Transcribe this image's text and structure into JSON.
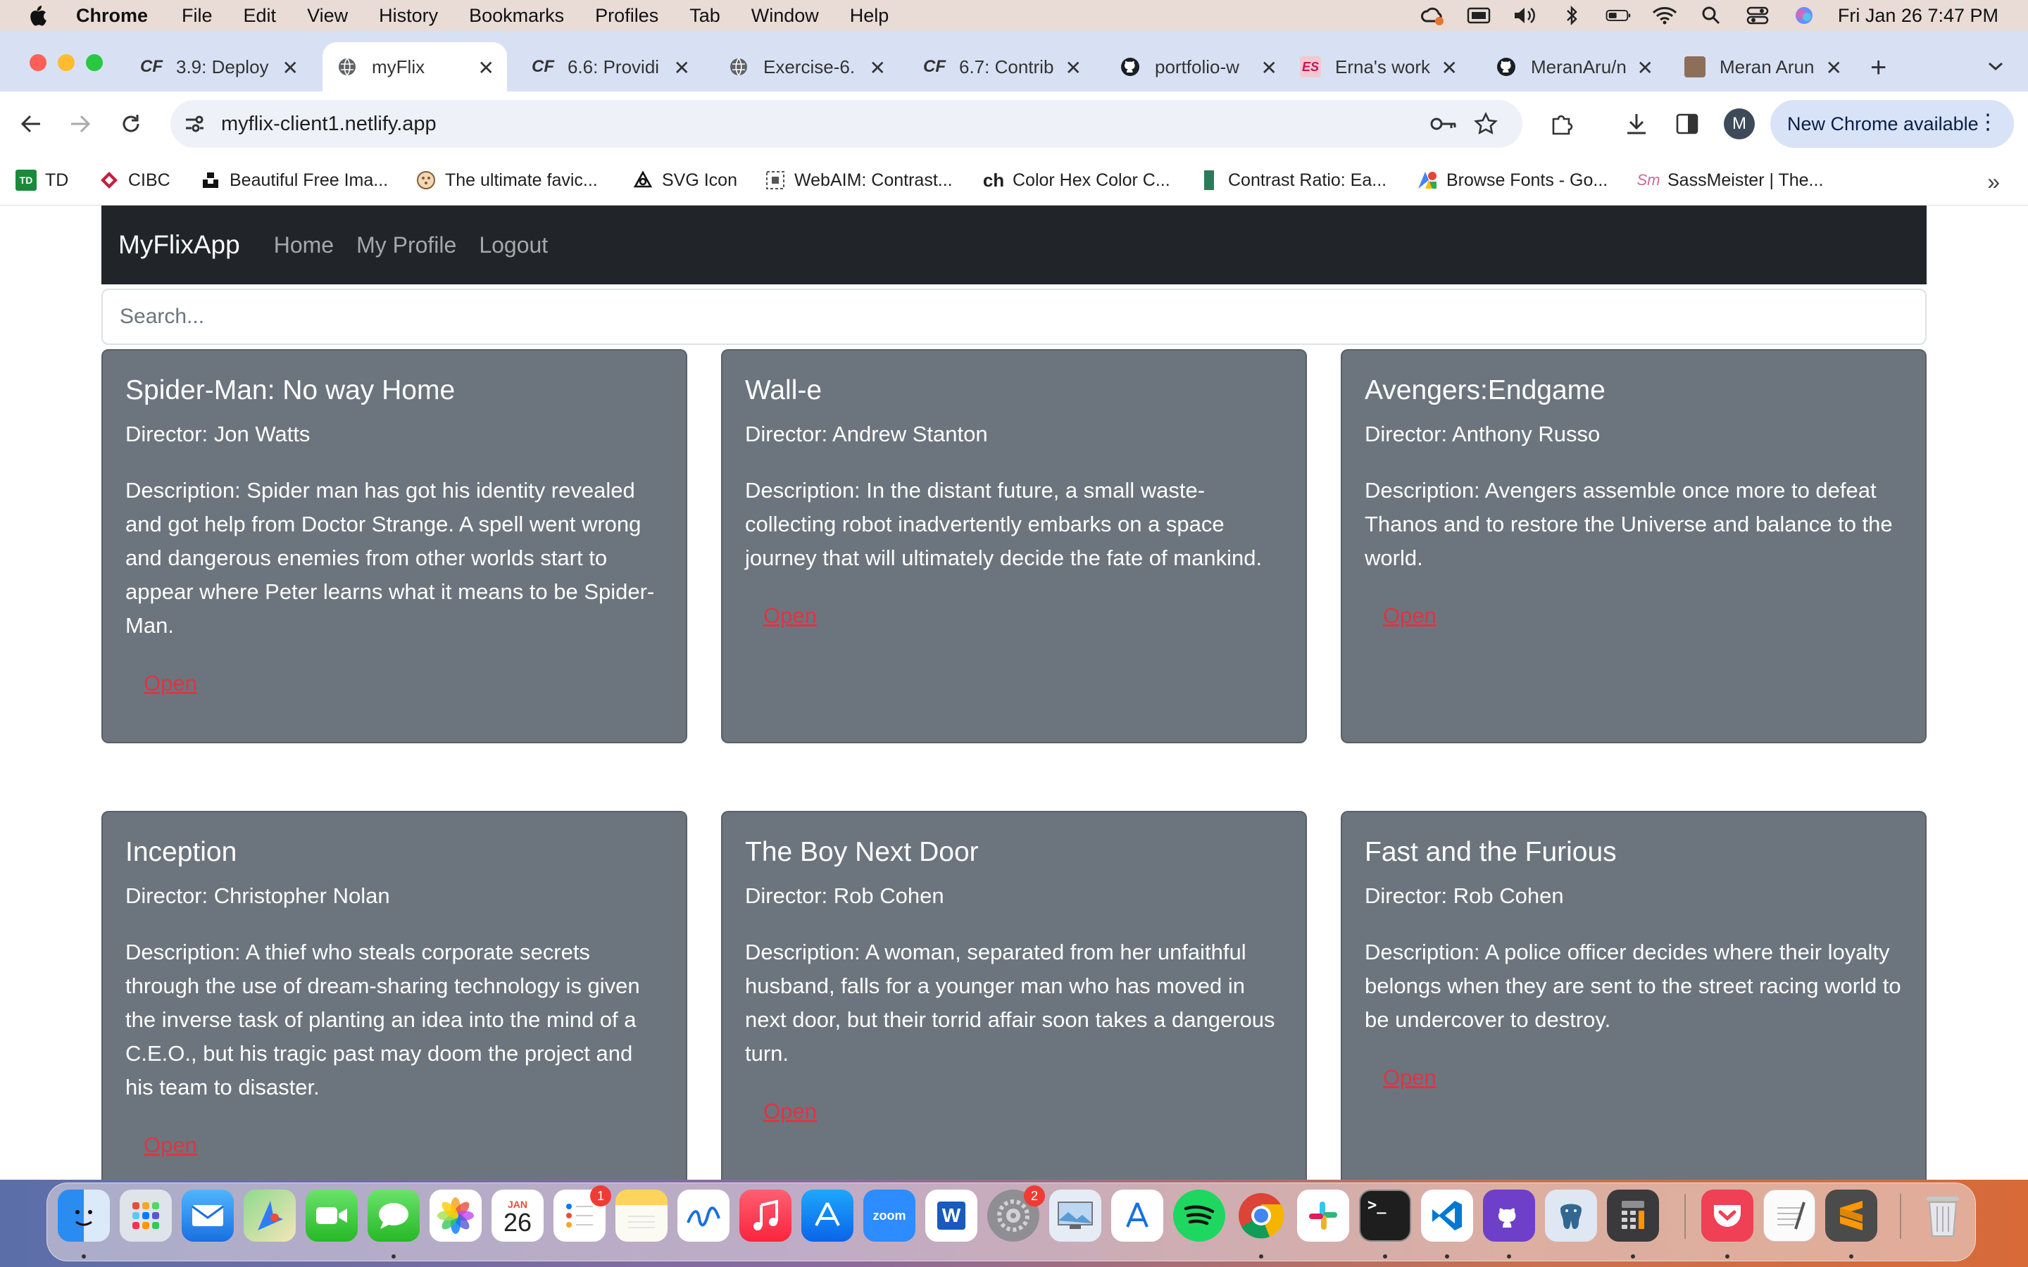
{
  "menubar": {
    "app_name": "Chrome",
    "items": [
      "File",
      "Edit",
      "View",
      "History",
      "Bookmarks",
      "Profiles",
      "Tab",
      "Window",
      "Help"
    ],
    "clock": "Fri Jan 26  7:47 PM"
  },
  "tabs": [
    {
      "title": "3.9: Deploy",
      "icon": "CF"
    },
    {
      "title": "myFlix",
      "icon": "globe"
    },
    {
      "title": "6.6: Providi",
      "icon": "CF"
    },
    {
      "title": "Exercise-6.",
      "icon": "globe"
    },
    {
      "title": "6.7: Contrib",
      "icon": "CF"
    },
    {
      "title": "portfolio-w",
      "icon": "github"
    },
    {
      "title": "Erna's work",
      "icon": "ES"
    },
    {
      "title": "MeranAru/n",
      "icon": "github"
    },
    {
      "title": "Meran Arun",
      "icon": "photo"
    }
  ],
  "toolbar": {
    "url": "myflix-client1.netlify.app",
    "profile_initial": "M",
    "update_label": "New Chrome available"
  },
  "bookmarks": [
    {
      "label": "TD",
      "icon": "TD"
    },
    {
      "label": "CIBC",
      "icon": "cibc"
    },
    {
      "label": "Beautiful Free Ima...",
      "icon": "unsplash"
    },
    {
      "label": "The ultimate favic...",
      "icon": "favicon"
    },
    {
      "label": "SVG Icon",
      "icon": "svg"
    },
    {
      "label": "WebAIM: Contrast...",
      "icon": "webaim"
    },
    {
      "label": "Color Hex Color C...",
      "icon": "ch"
    },
    {
      "label": "Contrast Ratio: Ea...",
      "icon": "contrast"
    },
    {
      "label": "Browse Fonts - Go...",
      "icon": "fonts"
    },
    {
      "label": "SassMeister | The...",
      "icon": "sass"
    }
  ],
  "app": {
    "brand": "MyFlixApp",
    "nav": [
      "Home",
      "My Profile",
      "Logout"
    ],
    "search_placeholder": "Search...",
    "open_label": "Open",
    "movies": [
      {
        "title": "Spider-Man: No way Home",
        "director": "Director: Jon Watts",
        "description": "Description: Spider man has got his identity revealed and got help from Doctor Strange. A spell went wrong and dangerous enemies from other worlds start to appear where Peter learns what it means to be Spider-Man."
      },
      {
        "title": "Wall-e",
        "director": "Director: Andrew Stanton",
        "description": "Description: In the distant future, a small waste-collecting robot inadvertently embarks on a space journey that will ultimately decide the fate of mankind."
      },
      {
        "title": "Avengers:Endgame",
        "director": "Director: Anthony Russo",
        "description": "Description: Avengers assemble once more to defeat Thanos and to restore the Universe and balance to the world."
      },
      {
        "title": "Inception",
        "director": "Director: Christopher Nolan",
        "description": "Description: A thief who steals corporate secrets through the use of dream-sharing technology is given the inverse task of planting an idea into the mind of a C.E.O., but his tragic past may doom the project and his team to disaster."
      },
      {
        "title": "The Boy Next Door",
        "director": "Director: Rob Cohen",
        "description": "Description: A woman, separated from her unfaithful husband, falls for a younger man who has moved in next door, but their torrid affair soon takes a dangerous turn."
      },
      {
        "title": "Fast and the Furious",
        "director": "Director: Rob Cohen",
        "description": "Description: A police officer decides where their loyalty belongs when they are sent to the street racing world to be undercover to destroy."
      }
    ]
  },
  "dock": {
    "calendar_month": "JAN",
    "calendar_day": "26",
    "reminders_badge": "1",
    "settings_badge": "2",
    "zoom_label": "zoom",
    "word_label": "W"
  }
}
